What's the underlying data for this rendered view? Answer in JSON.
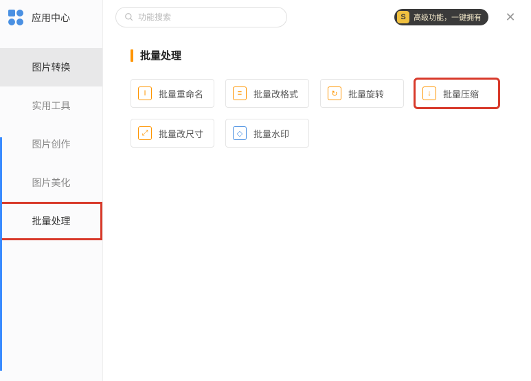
{
  "app": {
    "title": "应用中心"
  },
  "sidebar": {
    "items": [
      {
        "label": "图片转换"
      },
      {
        "label": "实用工具"
      },
      {
        "label": "图片创作"
      },
      {
        "label": "图片美化"
      },
      {
        "label": "批量处理"
      }
    ]
  },
  "search": {
    "placeholder": "功能搜索"
  },
  "promo": {
    "badge": "S",
    "text": "高级功能，一键拥有"
  },
  "section": {
    "title": "批量处理"
  },
  "tiles": [
    {
      "label": "批量重命名",
      "icon": "I",
      "cls": "ic-orange"
    },
    {
      "label": "批量改格式",
      "icon": "≡",
      "cls": "ic-orange"
    },
    {
      "label": "批量旋转",
      "icon": "↻",
      "cls": "ic-orange"
    },
    {
      "label": "批量压缩",
      "icon": "↓",
      "cls": "ic-orange",
      "highlight": true
    },
    {
      "label": "批量改尺寸",
      "icon": "⤢",
      "cls": "ic-orange"
    },
    {
      "label": "批量水印",
      "icon": "◇",
      "cls": "ic-blue"
    }
  ]
}
